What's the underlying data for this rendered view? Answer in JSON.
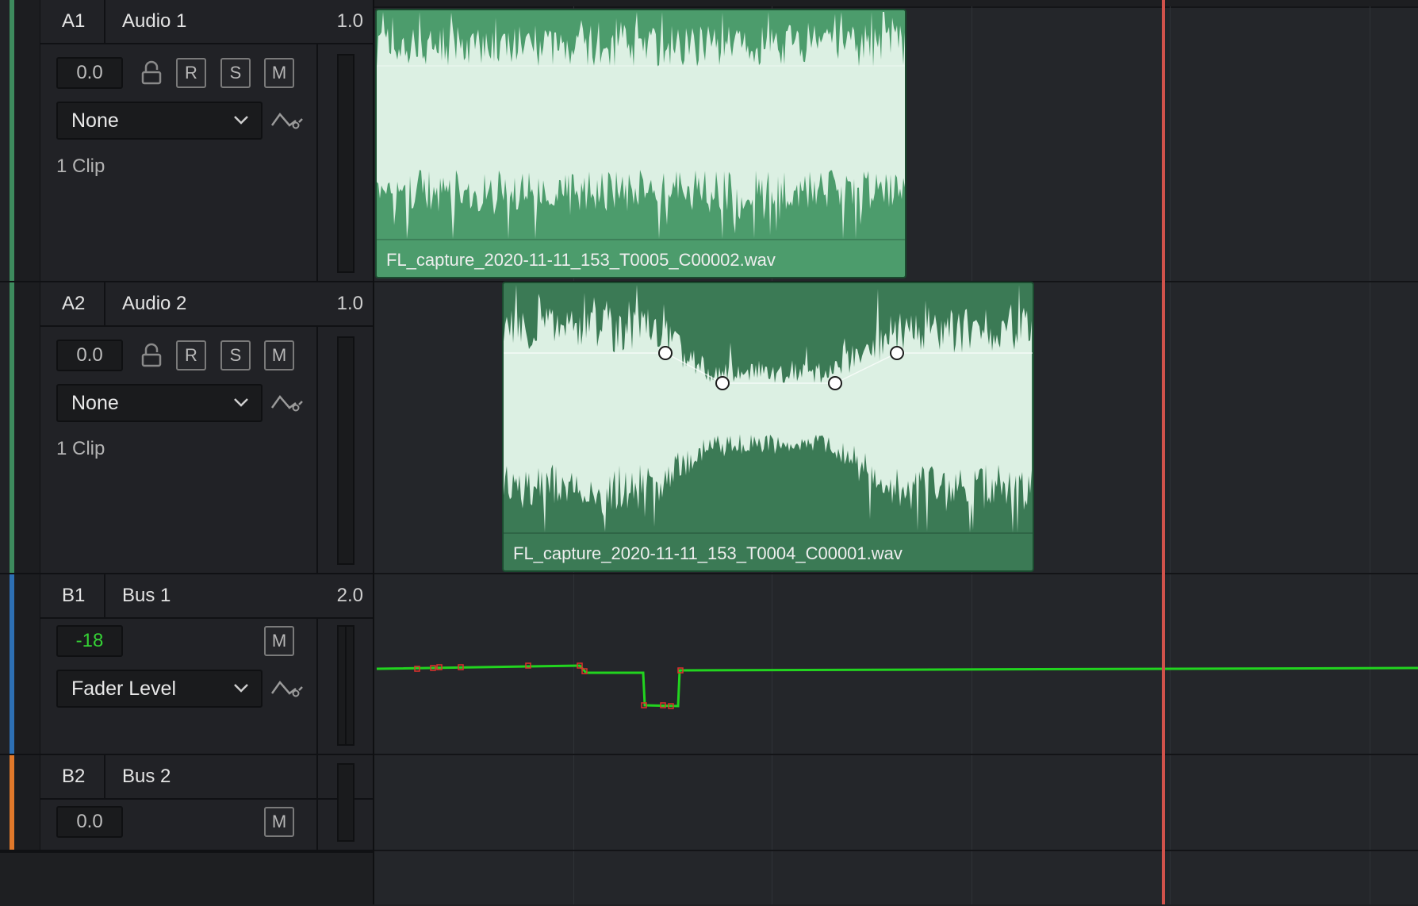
{
  "tracks": [
    {
      "id": "A1",
      "name": "Audio 1",
      "value": "1.0",
      "volume": "0.0",
      "buttons": {
        "r": "R",
        "s": "S",
        "m": "M"
      },
      "automation": "None",
      "clips": "1 Clip",
      "color": "#3d8a5d"
    },
    {
      "id": "A2",
      "name": "Audio 2",
      "value": "1.0",
      "volume": "0.0",
      "buttons": {
        "r": "R",
        "s": "S",
        "m": "M"
      },
      "automation": "None",
      "clips": "1 Clip",
      "color": "#3d8a5d"
    },
    {
      "id": "B1",
      "name": "Bus 1",
      "value": "2.0",
      "volume": "-18",
      "buttons": {
        "m": "M"
      },
      "automation": "Fader Level",
      "color": "#2d6fb3"
    },
    {
      "id": "B2",
      "name": "Bus 2",
      "value": "",
      "volume": "0.0",
      "buttons": {
        "m": "M"
      },
      "color": "#e0782a"
    }
  ],
  "clips": [
    {
      "filename": "FL_capture_2020-11-11_153_T0005_C00002.wav"
    },
    {
      "filename": "FL_capture_2020-11-11_153_T0004_C00001.wav"
    }
  ],
  "colors": {
    "clip_fill": "#4c9c6c",
    "clip_fill_dim": "#3b7a55",
    "waveform": "#dcf0e3",
    "automation": "#22d41f",
    "playhead": "#d0524b"
  },
  "icons": [
    "lock-icon",
    "automation-curve-icon",
    "chevron-down-icon"
  ]
}
